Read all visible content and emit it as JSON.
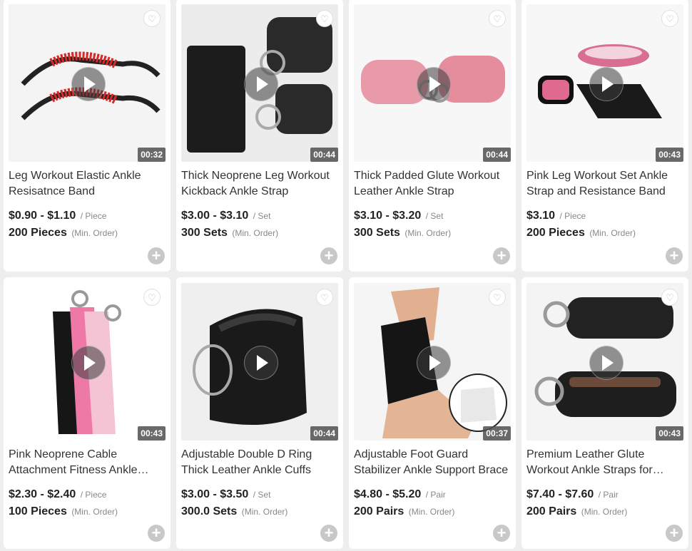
{
  "products": [
    {
      "title": "Leg Workout Elastic Ankle Resisatnce Band",
      "price": "$0.90 - $1.10",
      "unit": "/ Piece",
      "moq": "200 Pieces",
      "moq_note": "(Min. Order)",
      "duration": "00:32"
    },
    {
      "title": "Thick Neoprene Leg Workout Kickback Ankle Strap",
      "price": "$3.00 - $3.10",
      "unit": "/ Set",
      "moq": "300 Sets",
      "moq_note": "(Min. Order)",
      "duration": "00:44"
    },
    {
      "title": "Thick Padded Glute Workout Leather Ankle Strap",
      "price": "$3.10 - $3.20",
      "unit": "/ Set",
      "moq": "300 Sets",
      "moq_note": "(Min. Order)",
      "duration": "00:44"
    },
    {
      "title": "Pink Leg Workout Set Ankle Strap and Resistance Band",
      "price": "$3.10",
      "unit": "/ Piece",
      "moq": "200 Pieces",
      "moq_note": "(Min. Order)",
      "duration": "00:43"
    },
    {
      "title": "Pink Neoprene Cable Attachment Fitness Ankle Strap",
      "price": "$2.30 - $2.40",
      "unit": "/ Piece",
      "moq": "100 Pieces",
      "moq_note": "(Min. Order)",
      "duration": "00:43"
    },
    {
      "title": "Adjustable Double D Ring Thick Leather Ankle Cuffs",
      "price": "$3.00 - $3.50",
      "unit": "/ Set",
      "moq": "300.0 Sets",
      "moq_note": "(Min. Order)",
      "duration": "00:44"
    },
    {
      "title": "Adjustable Foot Guard Stabilizer Ankle Support Brace",
      "price": "$4.80 - $5.20",
      "unit": "/ Pair",
      "moq": "200 Pairs",
      "moq_note": "(Min. Order)",
      "duration": "00:37"
    },
    {
      "title": "Premium Leather Glute Workout Ankle Straps for Cabl...",
      "price": "$7.40 - $7.60",
      "unit": "/ Pair",
      "moq": "200 Pairs",
      "moq_note": "(Min. Order)",
      "duration": "00:43"
    }
  ],
  "icons": {
    "favorite": "heart-icon",
    "play": "play-icon",
    "add": "plus-circle-icon"
  },
  "colors": {
    "card_bg": "#ffffff",
    "page_bg": "#eeeeee",
    "add_button": "#c8c8c8"
  }
}
